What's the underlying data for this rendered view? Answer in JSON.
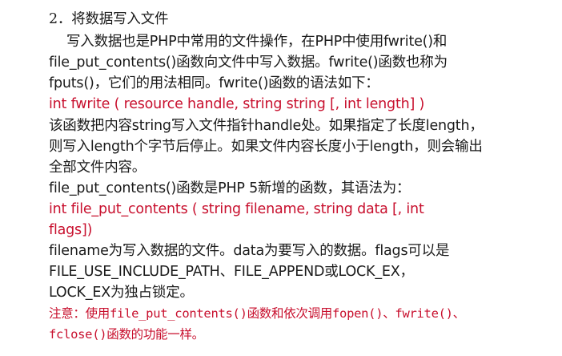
{
  "section": {
    "heading": "2．将数据写入文件"
  },
  "lines": [
    "写入数据也是PHP中常用的文件操作，在PHP中使用fwrite()和",
    "file_put_contents()函数向文件中写入数据。fwrite()函数也称为",
    "fputs()，它们的用法相同。fwrite()函数的语法如下："
  ],
  "fwrite_syntax": "int fwrite ( resource handle, string string [, int length] )",
  "fwrite_desc": [
    "该函数把内容string写入文件指针handle处。如果指定了长度length，",
    "则写入length个字节后停止。如果文件内容长度小于length，则会输出",
    "全部文件内容。"
  ],
  "fpc_intro": "file_put_contents()函数是PHP 5新增的函数，其语法为：",
  "fpc_syntax": [
    "int file_put_contents ( string filename, string data [, int",
    "flags])"
  ],
  "fpc_desc": [
    "filename为写入数据的文件。data为要写入的数据。flags可以是",
    "FILE_USE_INCLUDE_PATH、FILE_APPEND或LOCK_EX，",
    "LOCK_EX为独占锁定。"
  ],
  "note": [
    "注意：使用file_put_contents()函数和依次调用fopen()、fwrite()、",
    "fclose()函数的功能一样。"
  ]
}
